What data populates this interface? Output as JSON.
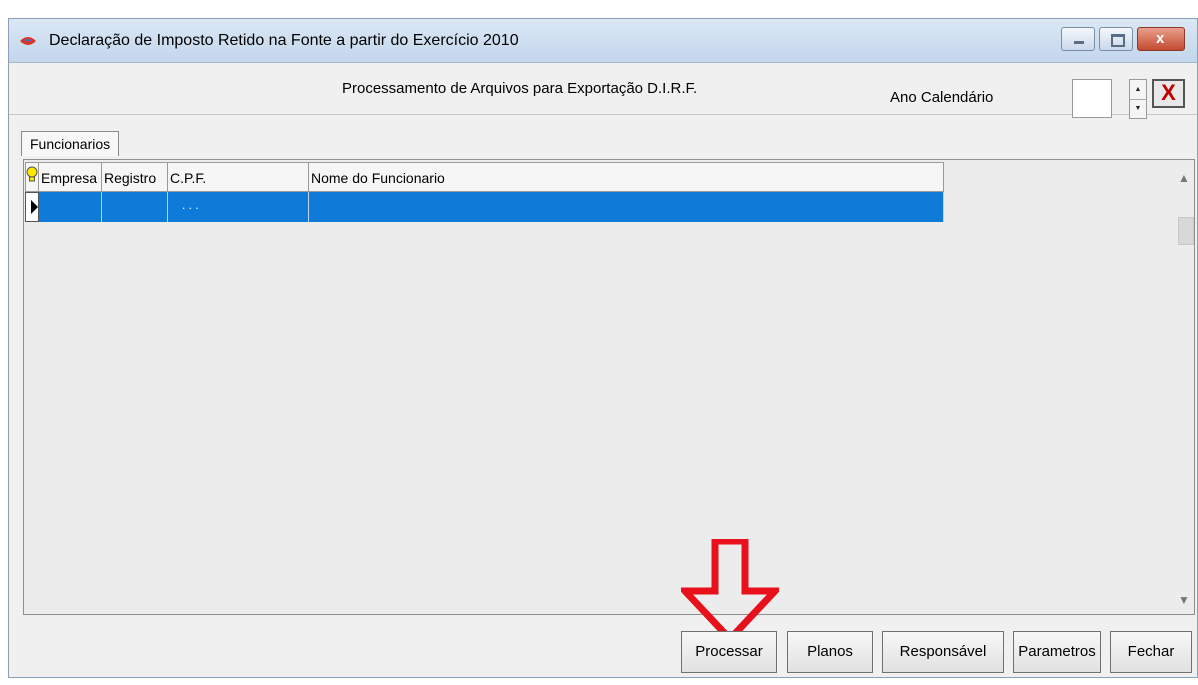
{
  "window": {
    "title": "Declaração de Imposto Retido na Fonte a partir do Exercício 2010",
    "icon": "app-icon",
    "controls": {
      "minimize": "minimize-icon",
      "maximize": "maximize-icon",
      "close": "x"
    }
  },
  "header": {
    "subtitle": "Processamento de Arquivos para Exportação D.I.R.F.",
    "ano_label": "Ano Calendário",
    "ano_value": "",
    "clear_button": "X"
  },
  "tabs": [
    {
      "label": "Funcionarios"
    }
  ],
  "grid": {
    "indicator_icon": "lightbulb-icon",
    "columns": [
      "Empresa",
      "Registro",
      "C.P.F.",
      "Nome do Funcionario"
    ],
    "rows": [
      {
        "empresa": "",
        "registro": "",
        "cpf": ". . .",
        "nome": ""
      }
    ],
    "selection_color": "#0d7bd7"
  },
  "annotation": {
    "color": "#e8111b",
    "shape": "down-arrow"
  },
  "buttons": {
    "processar": "Processar",
    "planos": "Planos",
    "responsavel": "Responsável",
    "parametros": "Parametros",
    "fechar": "Fechar"
  }
}
